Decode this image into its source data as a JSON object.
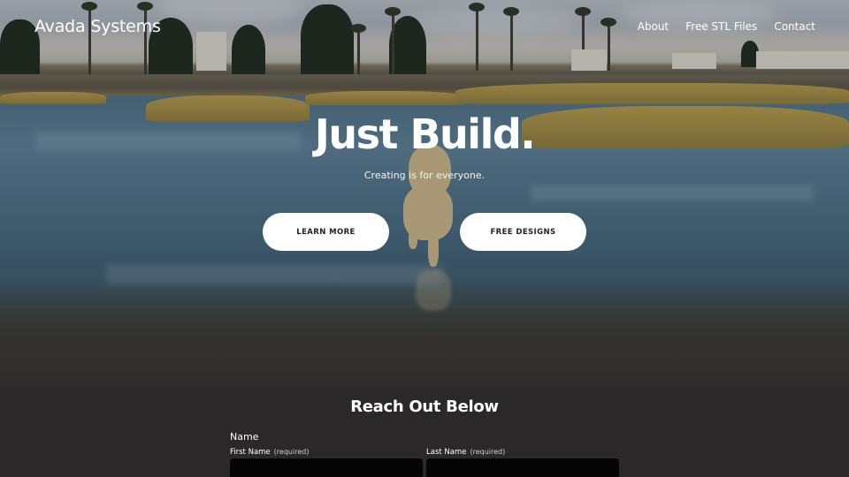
{
  "header": {
    "brand": "Avada Systems",
    "nav": [
      "About",
      "Free STL Files",
      "Contact"
    ]
  },
  "hero": {
    "headline": "Just Build.",
    "subline": "Creating is for everyone.",
    "buttons": {
      "learn_more": "LEARN MORE",
      "free_designs": "FREE DESIGNS"
    }
  },
  "contact": {
    "title": "Reach Out Below",
    "name_label": "Name",
    "first_name_label": "First Name",
    "last_name_label": "Last Name",
    "required_text": "(required)",
    "first_name_value": "",
    "last_name_value": ""
  },
  "colors": {
    "contact_bg": "#2a2828",
    "button_bg": "#ffffff",
    "input_bg": "#050505"
  }
}
